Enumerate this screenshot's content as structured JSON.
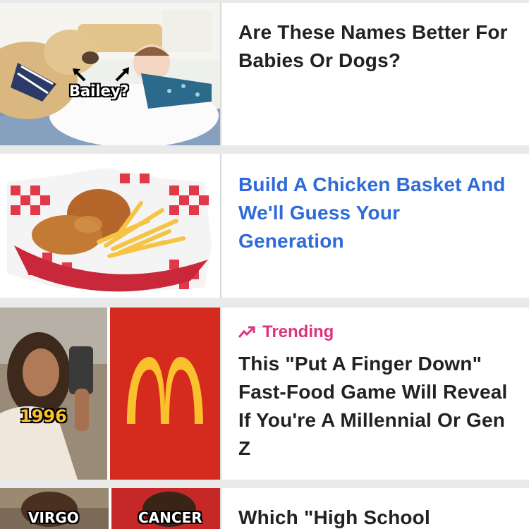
{
  "feed": {
    "items": [
      {
        "title": "Are These Names Better For Babies Or Dogs?",
        "image_caption": "Bailey?"
      },
      {
        "title": "Build A Chicken Basket And We'll Guess Your Generation"
      },
      {
        "badge": "Trending",
        "title": "This \"Put A Finger Down\" Fast-Food Game Will Reveal If You're A Millennial Or Gen Z",
        "image_year": "1996"
      },
      {
        "title": "Which \"High School",
        "image_left_label": "VIRGO",
        "image_right_label": "CANCER"
      }
    ]
  },
  "colors": {
    "link_blue": "#2f6bd8",
    "trending_pink": "#e0337e",
    "mcd_red": "#d52a1e",
    "mcd_yellow": "#fbc02d"
  }
}
